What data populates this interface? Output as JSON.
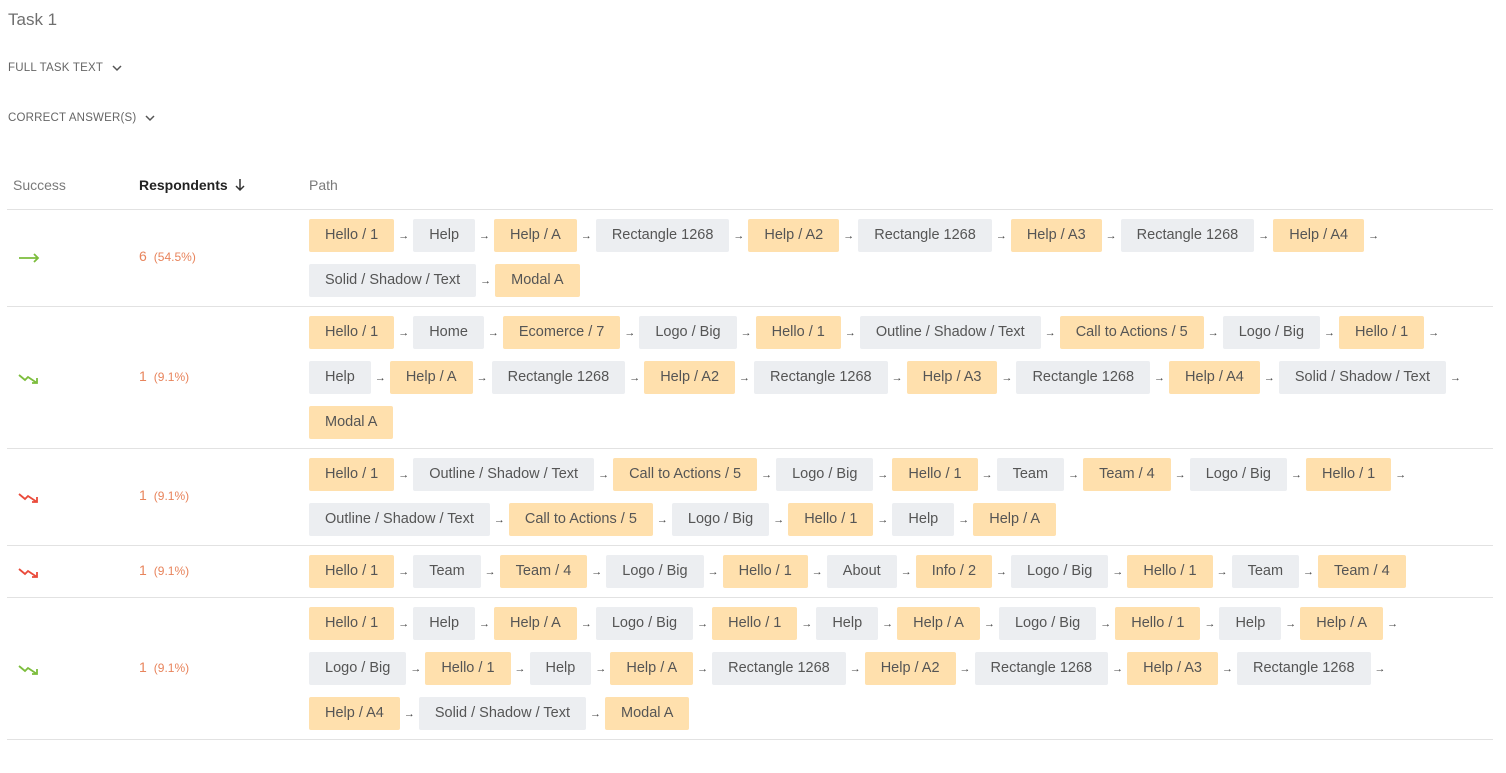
{
  "task": {
    "title": "Task 1"
  },
  "toggles": {
    "full_task_text": "FULL TASK TEXT",
    "correct_answers": "CORRECT ANSWER(S)"
  },
  "columns": {
    "success": "Success",
    "respondents": "Respondents",
    "path": "Path"
  },
  "colors": {
    "success_green": "#7cbd3c",
    "failure_red": "#ea4a3a",
    "respondent_orange": "#e8845c",
    "page_node": "#ffe0ad",
    "frame_node": "#eceef1"
  },
  "rows": [
    {
      "trend": "direct-success",
      "count": "6",
      "percent": "(54.5%)",
      "path": [
        [
          {
            "t": "Hello / 1",
            "k": "page"
          },
          {
            "t": "Help",
            "k": "frame"
          },
          {
            "t": "Help / A",
            "k": "page"
          },
          {
            "t": "Rectangle 1268",
            "k": "frame"
          },
          {
            "t": "Help / A2",
            "k": "page"
          },
          {
            "t": "Rectangle 1268",
            "k": "frame"
          },
          {
            "t": "Help / A3",
            "k": "page"
          },
          {
            "t": "Rectangle 1268",
            "k": "frame"
          },
          {
            "t": "Help / A4",
            "k": "page"
          }
        ],
        [
          {
            "t": "Solid / Shadow / Text",
            "k": "frame"
          },
          {
            "t": "Modal A",
            "k": "page"
          }
        ]
      ]
    },
    {
      "trend": "indirect-success",
      "count": "1",
      "percent": "(9.1%)",
      "path": [
        [
          {
            "t": "Hello / 1",
            "k": "page"
          },
          {
            "t": "Home",
            "k": "frame"
          },
          {
            "t": "Ecomerce / 7",
            "k": "page"
          },
          {
            "t": "Logo / Big",
            "k": "frame"
          },
          {
            "t": "Hello / 1",
            "k": "page"
          },
          {
            "t": "Outline / Shadow / Text",
            "k": "frame"
          },
          {
            "t": "Call to Actions / 5",
            "k": "page"
          },
          {
            "t": "Logo / Big",
            "k": "frame"
          },
          {
            "t": "Hello / 1",
            "k": "page"
          }
        ],
        [
          {
            "t": "Help",
            "k": "frame"
          },
          {
            "t": "Help / A",
            "k": "page"
          },
          {
            "t": "Rectangle 1268",
            "k": "frame"
          },
          {
            "t": "Help / A2",
            "k": "page"
          },
          {
            "t": "Rectangle 1268",
            "k": "frame"
          },
          {
            "t": "Help / A3",
            "k": "page"
          },
          {
            "t": "Rectangle 1268",
            "k": "frame"
          },
          {
            "t": "Help / A4",
            "k": "page"
          },
          {
            "t": "Solid / Shadow / Text",
            "k": "frame"
          }
        ],
        [
          {
            "t": "Modal A",
            "k": "page"
          }
        ]
      ]
    },
    {
      "trend": "failure",
      "count": "1",
      "percent": "(9.1%)",
      "path": [
        [
          {
            "t": "Hello / 1",
            "k": "page"
          },
          {
            "t": "Outline / Shadow / Text",
            "k": "frame"
          },
          {
            "t": "Call to Actions / 5",
            "k": "page"
          },
          {
            "t": "Logo / Big",
            "k": "frame"
          },
          {
            "t": "Hello / 1",
            "k": "page"
          },
          {
            "t": "Team",
            "k": "frame"
          },
          {
            "t": "Team / 4",
            "k": "page"
          },
          {
            "t": "Logo / Big",
            "k": "frame"
          },
          {
            "t": "Hello / 1",
            "k": "page"
          }
        ],
        [
          {
            "t": "Outline / Shadow / Text",
            "k": "frame"
          },
          {
            "t": "Call to Actions / 5",
            "k": "page"
          },
          {
            "t": "Logo / Big",
            "k": "frame"
          },
          {
            "t": "Hello / 1",
            "k": "page"
          },
          {
            "t": "Help",
            "k": "frame"
          },
          {
            "t": "Help / A",
            "k": "page"
          }
        ]
      ]
    },
    {
      "trend": "failure",
      "count": "1",
      "percent": "(9.1%)",
      "path": [
        [
          {
            "t": "Hello / 1",
            "k": "page"
          },
          {
            "t": "Team",
            "k": "frame"
          },
          {
            "t": "Team / 4",
            "k": "page"
          },
          {
            "t": "Logo / Big",
            "k": "frame"
          },
          {
            "t": "Hello / 1",
            "k": "page"
          },
          {
            "t": "About",
            "k": "frame"
          },
          {
            "t": "Info / 2",
            "k": "page"
          },
          {
            "t": "Logo / Big",
            "k": "frame"
          },
          {
            "t": "Hello / 1",
            "k": "page"
          },
          {
            "t": "Team",
            "k": "frame"
          },
          {
            "t": "Team / 4",
            "k": "page"
          }
        ]
      ]
    },
    {
      "trend": "indirect-success",
      "count": "1",
      "percent": "(9.1%)",
      "path": [
        [
          {
            "t": "Hello / 1",
            "k": "page"
          },
          {
            "t": "Help",
            "k": "frame"
          },
          {
            "t": "Help / A",
            "k": "page"
          },
          {
            "t": "Logo / Big",
            "k": "frame"
          },
          {
            "t": "Hello / 1",
            "k": "page"
          },
          {
            "t": "Help",
            "k": "frame"
          },
          {
            "t": "Help / A",
            "k": "page"
          },
          {
            "t": "Logo / Big",
            "k": "frame"
          },
          {
            "t": "Hello / 1",
            "k": "page"
          },
          {
            "t": "Help",
            "k": "frame"
          },
          {
            "t": "Help / A",
            "k": "page"
          }
        ],
        [
          {
            "t": "Logo / Big",
            "k": "frame"
          },
          {
            "t": "Hello / 1",
            "k": "page"
          },
          {
            "t": "Help",
            "k": "frame"
          },
          {
            "t": "Help / A",
            "k": "page"
          },
          {
            "t": "Rectangle 1268",
            "k": "frame"
          },
          {
            "t": "Help / A2",
            "k": "page"
          },
          {
            "t": "Rectangle 1268",
            "k": "frame"
          },
          {
            "t": "Help / A3",
            "k": "page"
          },
          {
            "t": "Rectangle 1268",
            "k": "frame"
          }
        ],
        [
          {
            "t": "Help / A4",
            "k": "page"
          },
          {
            "t": "Solid / Shadow / Text",
            "k": "frame"
          },
          {
            "t": "Modal A",
            "k": "page"
          }
        ]
      ]
    }
  ]
}
